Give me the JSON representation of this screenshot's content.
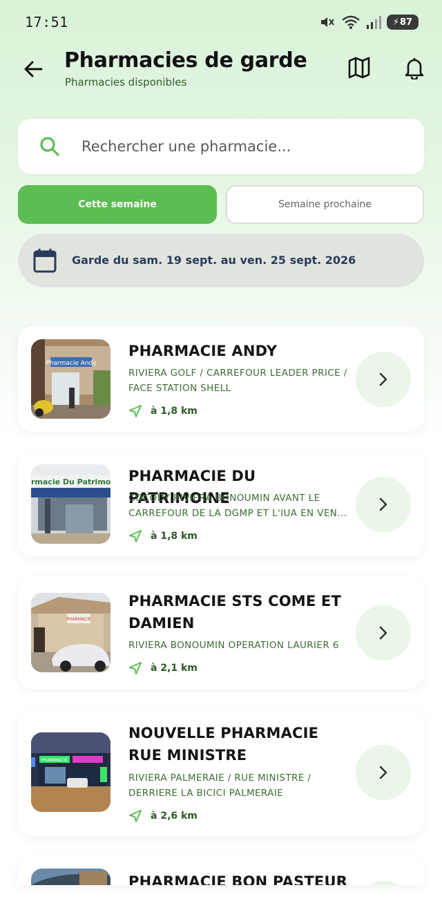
{
  "status": {
    "time": "17:51",
    "battery": "87"
  },
  "header": {
    "title": "Pharmacies de garde",
    "subtitle": "Pharmacies disponibles"
  },
  "search": {
    "placeholder": "Rechercher une pharmacie..."
  },
  "tabs": [
    {
      "label": "Cette semaine",
      "active": true
    },
    {
      "label": "Semaine prochaine",
      "active": false
    }
  ],
  "date_banner": {
    "text": "Garde du sam. 19 sept. au ven. 25 sept. 2026"
  },
  "pharmacies": [
    {
      "name": "PHARMACIE ANDY",
      "address": "RIVIERA GOLF / CARREFOUR LEADER PRICE / FACE STATION SHELL",
      "distance": "à 1,8 km",
      "photo_sign": "Pharmacie Andy"
    },
    {
      "name": "PHARMACIE DU PATRIMOINE",
      "address": "COCODY RIVIERA BONOUMIN AVANT LE CARREFOUR DE LA DGMP ET L'IUA EN VEN...",
      "distance": "à 1,8 km",
      "photo_sign": "rmacie Du Patrimoin"
    },
    {
      "name": "PHARMACIE STS COME ET DAMIEN",
      "address": "RIVIERA BONOUMIN OPERATION LAURIER 6",
      "distance": "à 2,1 km",
      "photo_sign": "PHARMACIE"
    },
    {
      "name": "NOUVELLE PHARMACIE RUE MINISTRE",
      "address": "RIVIERA PALMERAIE / RUE MINISTRE / DERRIERE LA BICICI PALMERAIE",
      "distance": "à 2,6 km",
      "photo_sign": "PHARMACIE"
    },
    {
      "name": "PHARMACIE BON PASTEUR"
    }
  ],
  "colors": {
    "accent": "#5bbd52",
    "address_green": "#3f6c37",
    "chevron_bg": "#e9f6e8",
    "banner_bg": "#dfe5de"
  },
  "icons": [
    "back-arrow-icon",
    "map-icon",
    "bell-icon",
    "search-icon",
    "calendar-icon",
    "navigation-arrow-icon",
    "chevron-right-icon"
  ]
}
